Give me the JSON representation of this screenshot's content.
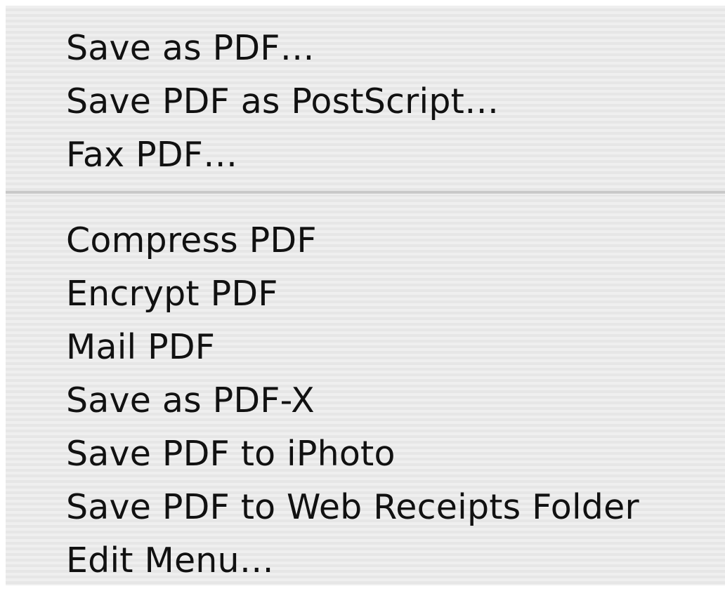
{
  "menu": {
    "group1": [
      {
        "label": "Save as PDF…"
      },
      {
        "label": "Save PDF as PostScript…"
      },
      {
        "label": "Fax PDF…"
      }
    ],
    "group2": [
      {
        "label": "Compress PDF"
      },
      {
        "label": "Encrypt PDF"
      },
      {
        "label": "Mail PDF"
      },
      {
        "label": "Save as PDF-X"
      },
      {
        "label": "Save PDF to iPhoto"
      },
      {
        "label": "Save PDF to Web Receipts Folder"
      },
      {
        "label": "Edit Menu…"
      }
    ]
  }
}
